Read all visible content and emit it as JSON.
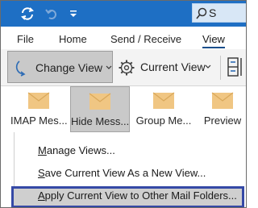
{
  "tabs": {
    "file": "File",
    "home": "Home",
    "send_receive": "Send / Receive",
    "view": "View"
  },
  "ribbon": {
    "change_view": "Change View",
    "current_view": "Current View"
  },
  "gallery": [
    {
      "label": "IMAP Mes...",
      "icon": "envelope-icon"
    },
    {
      "label": "Hide Mess...",
      "icon": "envelope-icon",
      "selected": true
    },
    {
      "label": "Group Me...",
      "icon": "envelope-icon"
    },
    {
      "label": "Preview",
      "icon": "envelope-icon"
    }
  ],
  "menu": {
    "manage_views": {
      "accel": "M",
      "rest": "anage Views..."
    },
    "save_view": {
      "accel": "S",
      "rest": "ave Current View As a New View..."
    },
    "apply_view": {
      "accel": "A",
      "rest": "pply Current View to Other Mail Folders..."
    }
  },
  "colors": {
    "title_bar": "#1e6fc4",
    "selected_fill": "#c9c9c9",
    "highlight_border": "#3549a6",
    "envelope": "#f0c683"
  }
}
